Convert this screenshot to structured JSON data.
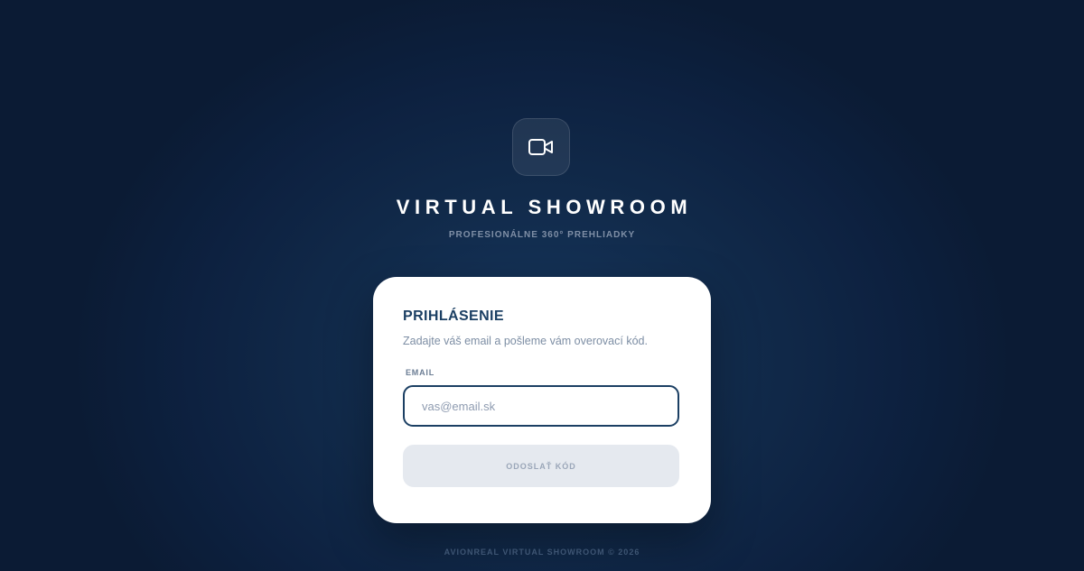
{
  "brand": {
    "icon": "video-camera-icon",
    "title": "VIRTUAL SHOWROOM",
    "subtitle": "PROFESIONÁLNE 360° PREHLIADKY"
  },
  "login": {
    "title": "PRIHLÁSENIE",
    "description": "Zadajte váš email a pošleme vám overovací kód.",
    "email_label": "EMAIL",
    "email_placeholder": "vas@email.sk",
    "email_value": "",
    "submit_label": "ODOSLAŤ KÓD"
  },
  "footer": {
    "text": "AVIONREAL VIRTUAL SHOWROOM © 2026"
  },
  "colors": {
    "background": "#0d2140",
    "accent": "#1b3f63",
    "card": "#ffffff",
    "button_disabled": "#e5e9ef"
  }
}
